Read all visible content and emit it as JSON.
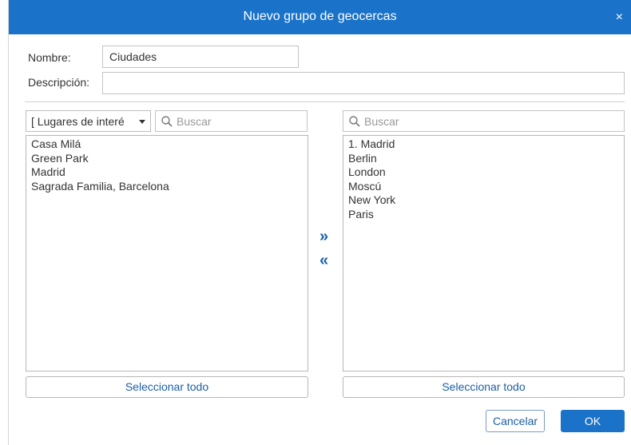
{
  "dialog": {
    "title": "Nuevo grupo de geocercas",
    "close_glyph": "×"
  },
  "form": {
    "name_label": "Nombre:",
    "name_value": "Ciudades",
    "description_label": "Descripción:",
    "description_value": ""
  },
  "left_panel": {
    "filter_selected": "[ Lugares de interé",
    "search_placeholder": "Buscar",
    "items": [
      "Casa Milá",
      "Green Park",
      "Madrid",
      "Sagrada Familia, Barcelona"
    ],
    "select_all_label": "Seleccionar todo"
  },
  "transfer": {
    "add_glyph": "»",
    "remove_glyph": "«"
  },
  "right_panel": {
    "search_placeholder": "Buscar",
    "items": [
      "1. Madrid",
      "Berlin",
      "London",
      "Moscú",
      "New York",
      "Paris"
    ],
    "select_all_label": "Seleccionar todo"
  },
  "footer": {
    "cancel_label": "Cancelar",
    "ok_label": "OK"
  },
  "colors": {
    "accent": "#1a73c9",
    "link": "#1a5fa8"
  },
  "icons": {
    "search": "search-icon",
    "close": "close-icon",
    "dropdown": "caret-down-icon"
  }
}
